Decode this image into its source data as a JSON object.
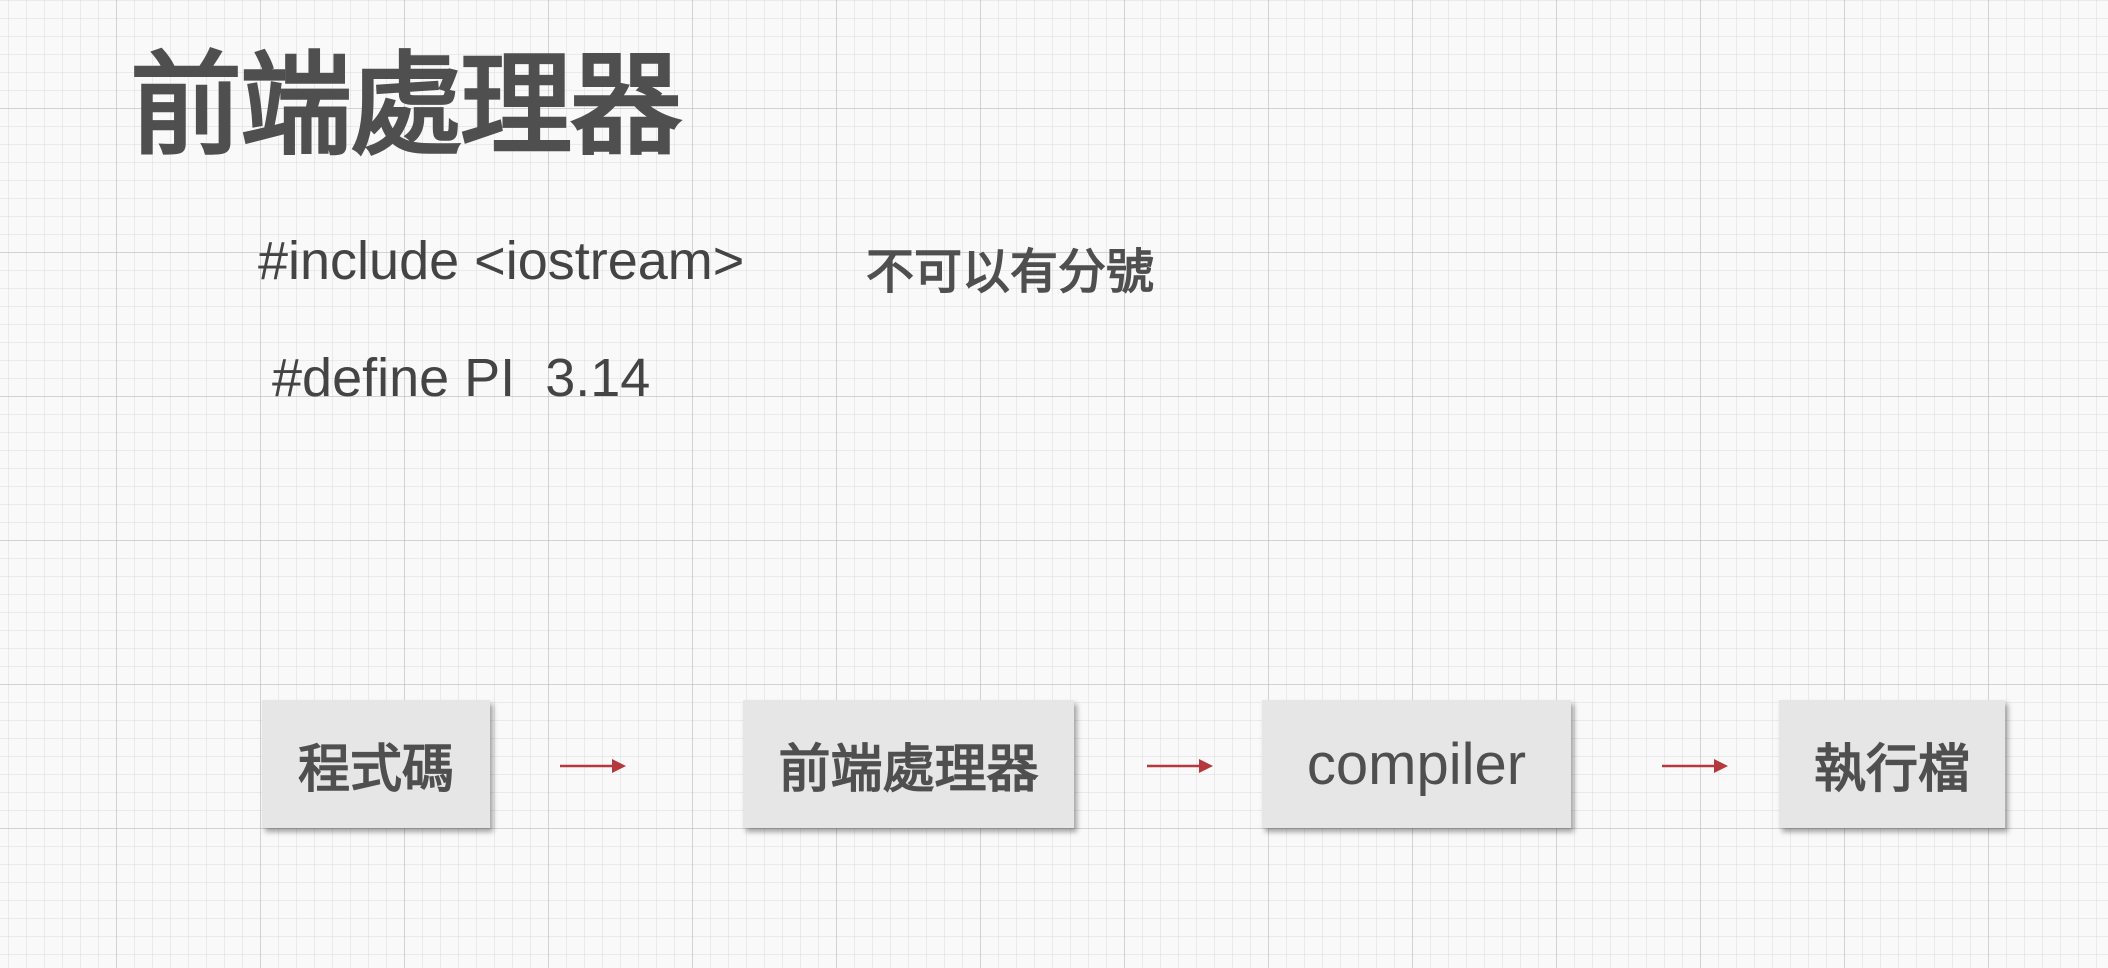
{
  "slide": {
    "title": "前端處理器"
  },
  "code_examples": {
    "include_line": "#include <iostream>",
    "define_line": "#define PI  3.14"
  },
  "note": "不可以有分號",
  "flow": {
    "steps": [
      {
        "label": "程式碼"
      },
      {
        "label": "前端處理器"
      },
      {
        "label": "compiler"
      },
      {
        "label": "執行檔"
      }
    ],
    "arrow_color": "#b5383c"
  },
  "colors": {
    "text": "#4f4f4f",
    "box_fill": "#e6e6e6",
    "background": "#f9f9f9",
    "grid_line": "#cfcfcf"
  }
}
